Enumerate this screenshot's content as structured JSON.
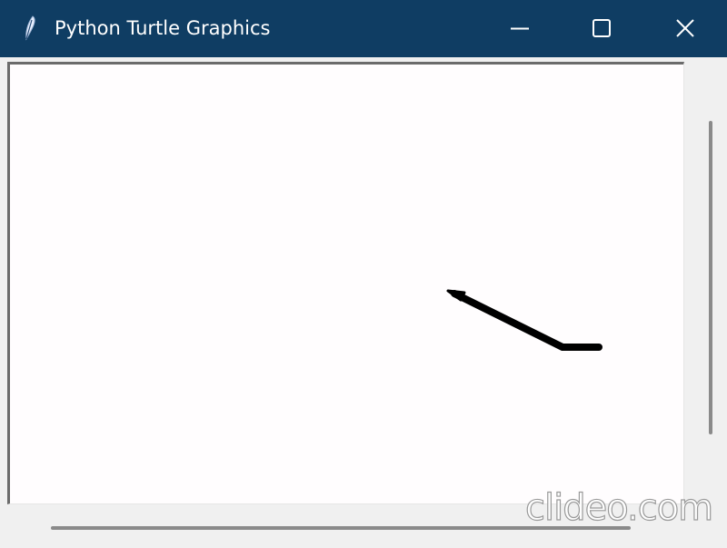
{
  "window": {
    "title": "Python Turtle Graphics",
    "app_icon": "feather-icon",
    "titlebar_color": "#0f3d63",
    "controls": {
      "minimize_icon": "minimize-icon",
      "maximize_icon": "maximize-icon",
      "close_icon": "close-icon"
    }
  },
  "canvas": {
    "background_color": "#fffdfe",
    "pen_color": "#000000",
    "turtle_shape": "arrow-cursor"
  },
  "watermark": {
    "text": "clideo.com"
  }
}
